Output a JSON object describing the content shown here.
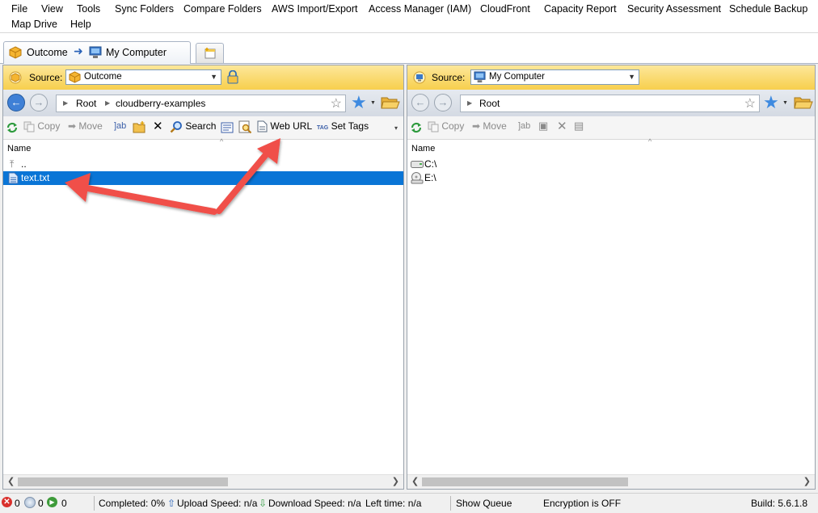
{
  "menu": {
    "items": [
      "File",
      "View",
      "Tools",
      "Sync Folders",
      "Compare Folders",
      "AWS Import/Export",
      "Access Manager (IAM)",
      "CloudFront",
      "Capacity Report",
      "Security Assessment",
      "Schedule Backup",
      "Map Drive",
      "Help"
    ]
  },
  "tab": {
    "source": "Outcome",
    "dest": "My Computer"
  },
  "left_pane": {
    "source_label": "Source:",
    "source_value": "Outcome",
    "breadcrumb": [
      "Root",
      "cloudberry-examples"
    ],
    "toolbar": {
      "copy": "Copy",
      "move": "Move",
      "search": "Search",
      "web_url": "Web URL",
      "set_tags": "Set Tags"
    },
    "column_name": "Name",
    "files": [
      {
        "name": "..",
        "selected": false
      },
      {
        "name": "text.txt",
        "selected": true
      }
    ]
  },
  "right_pane": {
    "source_label": "Source:",
    "source_value": "My Computer",
    "breadcrumb": [
      "Root"
    ],
    "toolbar": {
      "copy": "Copy",
      "move": "Move"
    },
    "column_name": "Name",
    "files": [
      {
        "name": "C:\\"
      },
      {
        "name": "E:\\"
      }
    ]
  },
  "status": {
    "errors": "0",
    "queued": "0",
    "running": "0",
    "completed": "Completed: 0%",
    "upload": "Upload Speed: n/a",
    "download": "Download Speed: n/a",
    "left_time": "Left time: n/a",
    "show_queue": "Show Queue",
    "encryption": "Encryption is OFF",
    "build": "Build: 5.6.1.8"
  },
  "colors": {
    "selection": "#0a75d6",
    "annotation_arrow": "#f0504a",
    "source_bar": "#f7cf4d"
  }
}
